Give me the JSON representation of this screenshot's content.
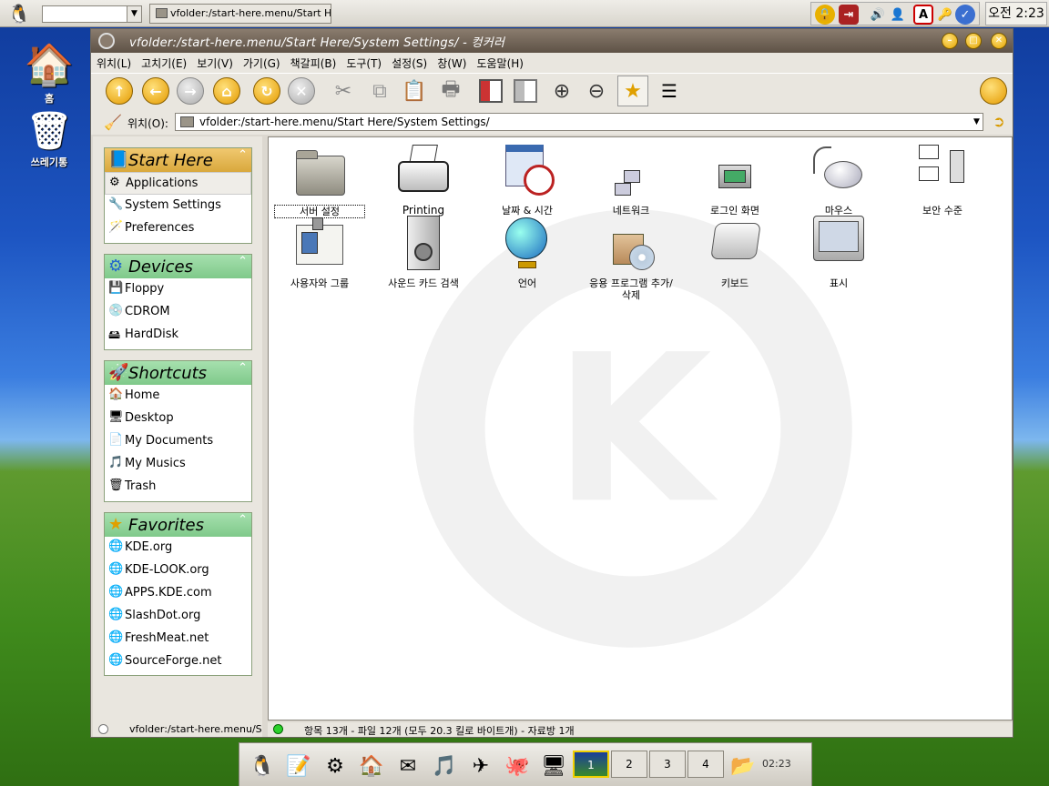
{
  "top_panel": {
    "task_title": "vfolder:/start-here.menu/Start He",
    "clock": "오전 2:23"
  },
  "desktop": {
    "icons": [
      {
        "label": "홈"
      },
      {
        "label": "쓰레기통"
      }
    ]
  },
  "window": {
    "title": "vfolder:/start-here.menu/Start Here/System Settings/ - 컹커러",
    "menu": [
      "위치(L)",
      "고치기(E)",
      "보기(V)",
      "가기(G)",
      "책갈피(B)",
      "도구(T)",
      "설정(S)",
      "창(W)",
      "도움말(H)"
    ],
    "location_label": "위치(O):",
    "location_value": "vfolder:/start-here.menu/Start Here/System Settings/"
  },
  "sidebar": {
    "start_here": {
      "title": "Start Here",
      "items": [
        "Applications",
        "System Settings",
        "Preferences"
      ]
    },
    "devices": {
      "title": "Devices",
      "items": [
        "Floppy",
        "CDROM",
        "HardDisk"
      ]
    },
    "shortcuts": {
      "title": "Shortcuts",
      "items": [
        "Home",
        "Desktop",
        "My Documents",
        "My Musics",
        "Trash"
      ]
    },
    "favorites": {
      "title": "Favorites",
      "items": [
        "KDE.org",
        "KDE-LOOK.org",
        "APPS.KDE.com",
        "SlashDot.org",
        "FreshMeat.net",
        "SourceForge.net"
      ]
    }
  },
  "files": [
    {
      "label": "서버 설정",
      "icon": "folder-icon"
    },
    {
      "label": "Printing",
      "icon": "printer-icon"
    },
    {
      "label": "날짜 & 시간",
      "icon": "calendar-clock-icon"
    },
    {
      "label": "네트워크",
      "icon": "network-icon"
    },
    {
      "label": "로그인 화면",
      "icon": "login-screen-icon"
    },
    {
      "label": "마우스",
      "icon": "mouse-icon"
    },
    {
      "label": "보안 수준",
      "icon": "security-level-icon"
    },
    {
      "label": "사용자와 그룹",
      "icon": "user-card-icon"
    },
    {
      "label": "사운드 카드 검색",
      "icon": "speaker-icon"
    },
    {
      "label": "언어",
      "icon": "globe-icon"
    },
    {
      "label": "응용 프로그램 추가/삭제",
      "icon": "package-icon"
    },
    {
      "label": "키보드",
      "icon": "keyboard-key-icon"
    },
    {
      "label": "표시",
      "icon": "display-icon"
    }
  ],
  "status": {
    "left": "vfolder:/start-here.menu/S",
    "right": "항목 13개 - 파일 12개 (모두 20.3 킬로 바이트개) - 자료방 1개"
  },
  "bottom_panel": {
    "desktops": [
      "1",
      "2",
      "3",
      "4"
    ],
    "clock": "02:23"
  },
  "colors": {
    "panel_header": "#d9a83c",
    "panel_header_green": "#7fc98a",
    "titlebar": "#6e6256"
  }
}
